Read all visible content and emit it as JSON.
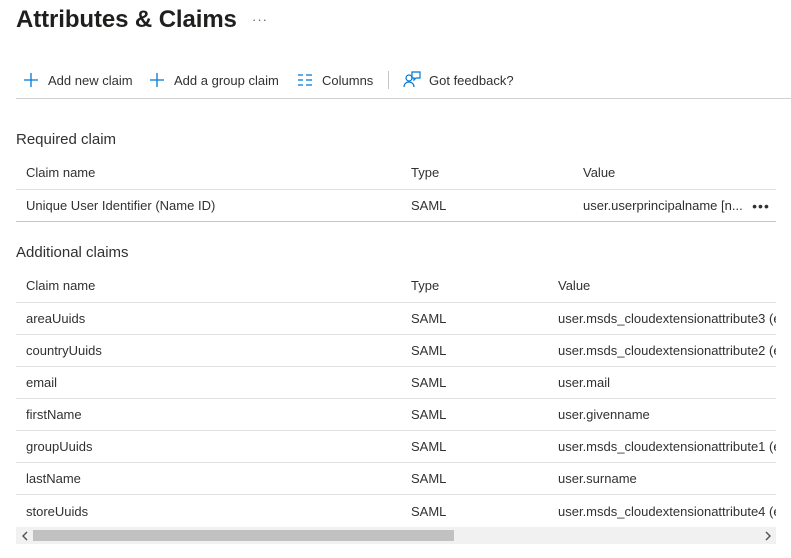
{
  "header": {
    "title": "Attributes & Claims",
    "more": "···"
  },
  "toolbar": {
    "add_new_claim": "Add new claim",
    "add_group_claim": "Add a group claim",
    "columns": "Columns",
    "feedback": "Got feedback?"
  },
  "required": {
    "title": "Required claim",
    "columns": [
      "Claim name",
      "Type",
      "Value"
    ],
    "rows": [
      {
        "name": "Unique User Identifier (Name ID)",
        "type": "SAML",
        "value": "user.userprincipalname [n...",
        "more": "•••"
      }
    ]
  },
  "additional": {
    "title": "Additional claims",
    "columns": [
      "Claim name",
      "Type",
      "Value"
    ],
    "rows": [
      {
        "name": "areaUuids",
        "type": "SAML",
        "value": "user.msds_cloudextensionattribute3 (e"
      },
      {
        "name": "countryUuids",
        "type": "SAML",
        "value": "user.msds_cloudextensionattribute2 (e"
      },
      {
        "name": "email",
        "type": "SAML",
        "value": "user.mail"
      },
      {
        "name": "firstName",
        "type": "SAML",
        "value": "user.givenname"
      },
      {
        "name": "groupUuids",
        "type": "SAML",
        "value": "user.msds_cloudextensionattribute1 (e"
      },
      {
        "name": "lastName",
        "type": "SAML",
        "value": "user.surname"
      },
      {
        "name": "storeUuids",
        "type": "SAML",
        "value": "user.msds_cloudextensionattribute4 (e"
      }
    ]
  },
  "scrollbar": {
    "position": 0,
    "visible_fraction": 0.58
  },
  "colors": {
    "accent": "#0078d4",
    "border": "#e1dfdd"
  }
}
